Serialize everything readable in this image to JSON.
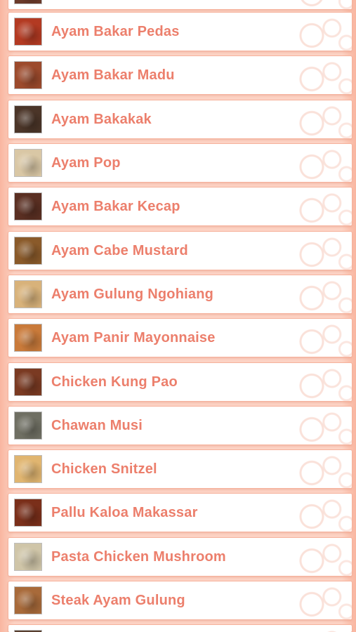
{
  "list": {
    "items": [
      {
        "label": "",
        "thumb_color": "#6b3a2a"
      },
      {
        "label": "Ayam Bakar Pedas",
        "thumb_color": "#b33a22"
      },
      {
        "label": "Ayam Bakar Madu",
        "thumb_color": "#9c4a2c"
      },
      {
        "label": "Ayam Bakakak",
        "thumb_color": "#4b3528"
      },
      {
        "label": "Ayam Pop",
        "thumb_color": "#d9c7a5"
      },
      {
        "label": "Ayam Bakar Kecap",
        "thumb_color": "#5a2f22"
      },
      {
        "label": "Ayam Cabe Mustard",
        "thumb_color": "#8a5a2a"
      },
      {
        "label": "Ayam Gulung Ngohiang",
        "thumb_color": "#d8b27a"
      },
      {
        "label": "Ayam Panir Mayonnaise",
        "thumb_color": "#c97a3a"
      },
      {
        "label": "Chicken Kung Pao",
        "thumb_color": "#7a3a22"
      },
      {
        "label": "Chawan Musi",
        "thumb_color": "#6f6f63"
      },
      {
        "label": "Chicken Snitzel",
        "thumb_color": "#e0b570"
      },
      {
        "label": "Pallu Kaloa Makassar",
        "thumb_color": "#7a2f1a"
      },
      {
        "label": "Pasta Chicken Mushroom",
        "thumb_color": "#cfc5a8"
      },
      {
        "label": "Steak Ayam Gulung",
        "thumb_color": "#a86a3a"
      },
      {
        "label": "",
        "thumb_color": "#5a4030"
      }
    ]
  }
}
